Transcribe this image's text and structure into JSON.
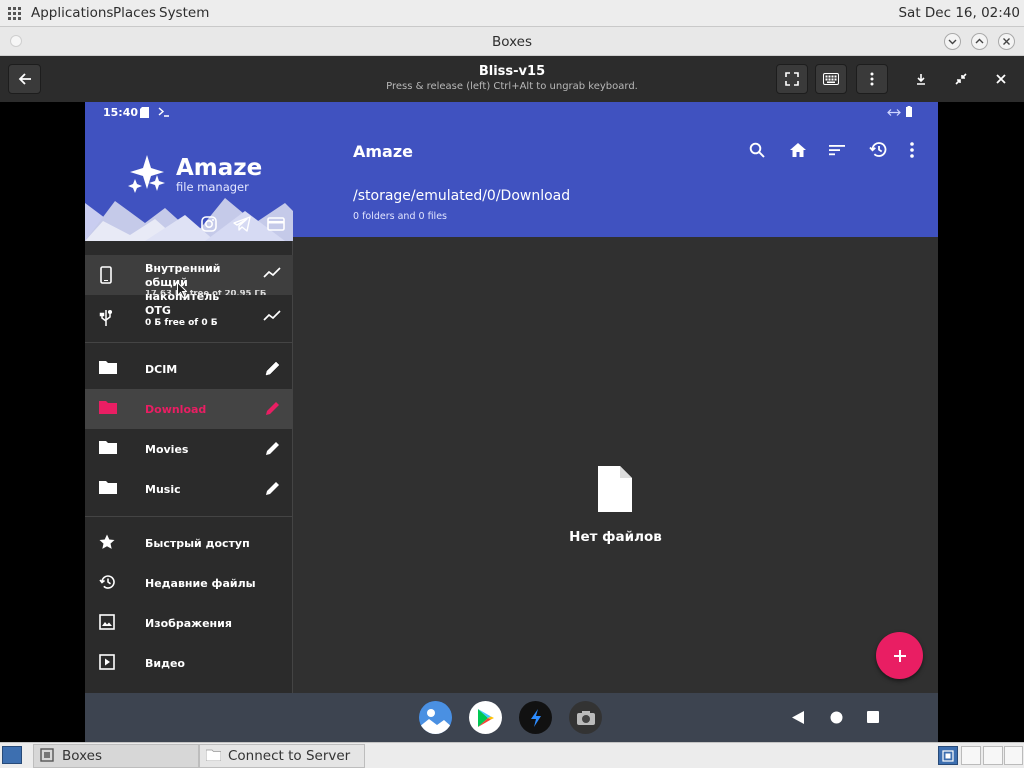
{
  "top_panel": {
    "menus": [
      "Applications",
      "Places",
      "System"
    ],
    "clock": "Sat Dec 16, 02:40"
  },
  "window": {
    "title": "Boxes"
  },
  "boxes_header": {
    "vm_name": "Bliss-v15",
    "hint": "Press & release (left) Ctrl+Alt to ungrab keyboard."
  },
  "android": {
    "status": {
      "time": "15:40"
    },
    "drawer": {
      "app_name": "Amaze",
      "app_subtitle": "file manager",
      "storage": [
        {
          "label": "Внутренний общий накопитель",
          "detail": "17,63 ГБ free of 20,95 ГБ"
        },
        {
          "label": "OTG",
          "detail": "0 Б free of 0 Б"
        }
      ],
      "folders": [
        {
          "label": "DCIM",
          "active": false
        },
        {
          "label": "Download",
          "active": true
        },
        {
          "label": "Movies",
          "active": false
        },
        {
          "label": "Music",
          "active": false
        }
      ],
      "quick": [
        {
          "label": "Быстрый доступ",
          "icon": "star-icon"
        },
        {
          "label": "Недавние файлы",
          "icon": "history-icon"
        },
        {
          "label": "Изображения",
          "icon": "image-icon"
        },
        {
          "label": "Видео",
          "icon": "video-icon"
        }
      ]
    },
    "appbar": {
      "title": "Amaze",
      "path": "/storage/emulated/0/Download",
      "summary": "0 folders and 0 files"
    },
    "empty_text": "Нет файлов"
  },
  "taskbar": {
    "items": [
      "Boxes",
      "Connect to Server"
    ]
  },
  "colors": {
    "accent": "#4052c0",
    "fab": "#e91e63",
    "active_item": "#e91e63"
  }
}
